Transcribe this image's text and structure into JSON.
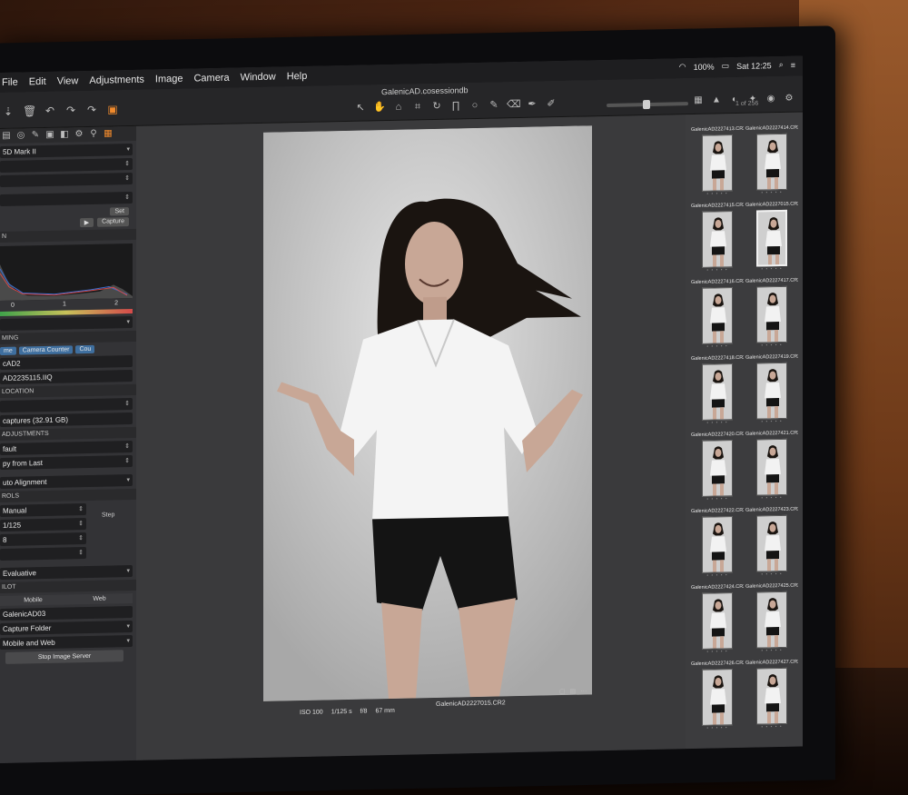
{
  "menubar": {
    "items": [
      "File",
      "Edit",
      "View",
      "Adjustments",
      "Image",
      "Camera",
      "Window",
      "Help"
    ],
    "status": {
      "battery": "100%",
      "clock": "Sat 12:25"
    }
  },
  "toolbar": {
    "document_title": "GalenicAD.cosessiondb",
    "left_icons": [
      "import-icon",
      "delete-icon",
      "undo-icon",
      "redo-icon",
      "forward-icon",
      "camera-capture-icon"
    ],
    "tool_icons": [
      "select-icon",
      "pan-icon",
      "loupe-icon",
      "crop-icon",
      "rotate-icon",
      "keystone-icon",
      "spot-icon",
      "brush-icon",
      "eraser-icon",
      "picker-icon",
      "annotate-icon"
    ],
    "right_icons": [
      "grid-view-icon",
      "warning-icon",
      "exposure-icon",
      "focus-icon",
      "palette-icon",
      "settings-icon"
    ],
    "count_label": "1 of 256"
  },
  "left_panel": {
    "tab_icons": [
      "library-icon",
      "capture-icon",
      "lens-icon",
      "color-icon",
      "exposure-icon",
      "details-icon",
      "adjust-icon",
      "meta-icon"
    ],
    "camera_model": "5D Mark II",
    "set_label": "Set",
    "capture_label": "Capture",
    "histogram_section": "N",
    "hist_ticks": [
      "0",
      "1",
      "2"
    ],
    "naming_section": "MING",
    "naming_buttons": [
      "me",
      "Camera Counter",
      "Cou"
    ],
    "folder_name": "cAD2",
    "file_name": "AD2235115.IIQ",
    "location_section": "LOCATION",
    "captures_label": "captures (32.91 GB)",
    "adjustments_section": "ADJUSTMENTS",
    "adjust_value": "fault",
    "copy_from_last": "py from Last",
    "auto_alignment": "uto Alignment",
    "controls_section": "ROLS",
    "manual_label": "Manual",
    "shutter": "1/125",
    "step_label": "Step",
    "aperture": "8",
    "metering": "Evaluative",
    "pilot_section": "ILOT",
    "web_tab": "Web",
    "mobile_tab": "Mobile",
    "pilot_name": "GalenicAD03",
    "capture_folder": "Capture Folder",
    "mobile_and_web": "Mobile and Web",
    "stop_image_server": "Stop Image Server"
  },
  "viewer": {
    "exif": [
      "ISO 100",
      "1/125 s",
      "f/8",
      "67 mm"
    ],
    "filename": "GalenicAD2227015.CR2"
  },
  "filmstrip": {
    "items": [
      {
        "name": "GalenicAD2227413.CR2",
        "selected": false
      },
      {
        "name": "GalenicAD2227414.CR2",
        "selected": false
      },
      {
        "name": "GalenicAD2227415.CR2",
        "selected": false
      },
      {
        "name": "GalenicAD2227015.CR2",
        "selected": true
      },
      {
        "name": "GalenicAD2227416.CR2",
        "selected": false
      },
      {
        "name": "GalenicAD2227417.CR2",
        "selected": false
      },
      {
        "name": "GalenicAD2227418.CR2",
        "selected": false
      },
      {
        "name": "GalenicAD2227419.CR2",
        "selected": false
      },
      {
        "name": "GalenicAD2227420.CR2",
        "selected": false
      },
      {
        "name": "GalenicAD2227421.CR2",
        "selected": false
      },
      {
        "name": "GalenicAD2227422.CR2",
        "selected": false
      },
      {
        "name": "GalenicAD2227423.CR2",
        "selected": false
      },
      {
        "name": "GalenicAD2227424.CR2",
        "selected": false
      },
      {
        "name": "GalenicAD2227425.CR2",
        "selected": false
      },
      {
        "name": "GalenicAD2227426.CR2",
        "selected": false
      },
      {
        "name": "GalenicAD2227427.CR2",
        "selected": false
      }
    ]
  },
  "colors": {
    "accent": "#f08a2c",
    "panel": "#333336",
    "viewer": "#3a3a3c",
    "naming_button": "#3f6f9f"
  }
}
